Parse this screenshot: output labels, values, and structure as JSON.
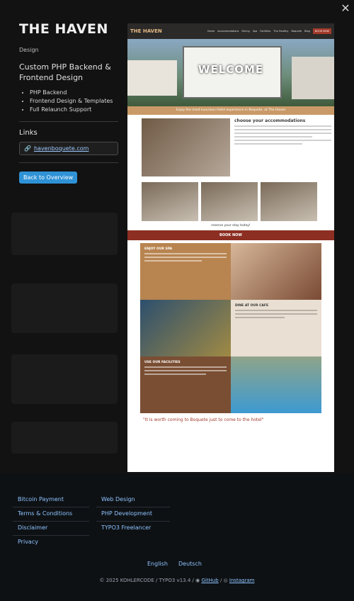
{
  "project": {
    "title": "THE HAVEN",
    "category": "Design",
    "heading": "Custom PHP Backend & Frontend Design",
    "features": [
      "PHP Backend",
      "Frontend Design & Templates",
      "Full Relaunch Support"
    ],
    "links_title": "Links",
    "link_label": "havenboquete.com",
    "back_label": "Back to Overview"
  },
  "screenshot": {
    "logo": "THE HAVEN",
    "nav_items": [
      "Home",
      "Accommodations",
      "Dining",
      "Spa",
      "Facilities",
      "The Healthy",
      "Boquete",
      "Blog"
    ],
    "book_label": "BOOK NOW",
    "hero_title": "WELCOME",
    "banner": "Enjoy the most luxurious Hotel experience in Boquete, at The Haven",
    "accom_title": "choose your accommodations",
    "reserve": "reserve your stay today!",
    "book_bar": "BOOK NOW",
    "spa_title": "ENJOY OUR SPA",
    "cafe_title": "DINE AT OUR CAFE",
    "facilities_title": "USE OUR FACILITIES",
    "quote": "\"It is worth coming to Boquete just to come to the hotel\""
  },
  "footer": {
    "col1": [
      "Bitcoin Payment",
      "Terms & Conditions",
      "Disclaimer",
      "Privacy"
    ],
    "col2": [
      "Web Design",
      "PHP Development",
      "TYPO3 Freelancer"
    ],
    "languages": [
      "English",
      "Deutsch"
    ],
    "copyright": "© 2025 KOHLERCODE / TYPO3 v13.4 /",
    "github": "GitHub",
    "instagram": "Instagram"
  },
  "icons": {
    "close": "close-icon",
    "link": "link-icon",
    "github": "github-icon",
    "instagram": "instagram-icon"
  }
}
